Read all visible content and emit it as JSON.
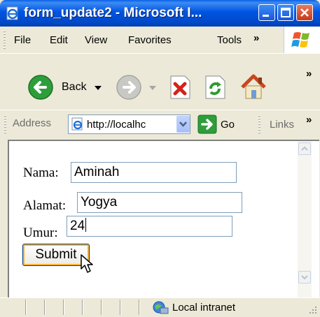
{
  "window": {
    "title": "form_update2 - Microsoft I..."
  },
  "menu": {
    "items": [
      "File",
      "Edit",
      "View",
      "Favorites",
      "Tools"
    ],
    "overflow": "»"
  },
  "toolbar": {
    "back_label": "Back",
    "overflow": "»"
  },
  "address_bar": {
    "label": "Address",
    "url": "http://localhc",
    "go_label": "Go",
    "links_label": "Links",
    "links_overflow": "»"
  },
  "form": {
    "nama_label": "Nama:",
    "nama_value": "Aminah",
    "alamat_label": "Alamat:",
    "alamat_value": "Yogya",
    "umur_label": "Umur:",
    "umur_value": "24",
    "submit_label": "Submit"
  },
  "status_bar": {
    "zone": "Local intranet"
  },
  "colors": {
    "titlebar": "#0054E3",
    "window_bg": "#ECE9D8",
    "input_border": "#7F9DB9",
    "button_focus": "#F8B33C"
  },
  "icons": {
    "title": "ie-page-icon",
    "back": "back-arrow-icon",
    "forward": "forward-arrow-icon",
    "stop": "stop-icon",
    "refresh": "refresh-icon",
    "home": "home-icon",
    "go": "go-arrow-icon",
    "status": "local-intranet-icon",
    "cursor": "mouse-pointer-icon"
  }
}
